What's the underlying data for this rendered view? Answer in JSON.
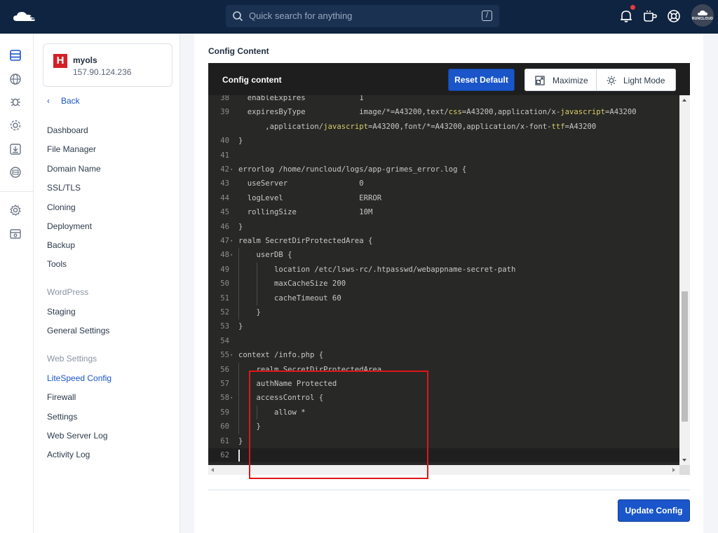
{
  "topbar": {
    "search_placeholder": "Quick search for anything",
    "search_shortcut": "/",
    "avatar_text": "RUNCLOUD",
    "icons": [
      "cloud-logo-icon",
      "search-icon",
      "bell-icon",
      "coffee-cup-icon",
      "help-lifebuoy-icon"
    ]
  },
  "rail": {
    "icons": [
      "servers-icon",
      "globe-icon",
      "bug-icon",
      "settings-cog-icon",
      "download-box-icon",
      "network-globe-icon",
      "gear-icon",
      "archive-box-icon"
    ]
  },
  "server": {
    "name": "myols",
    "ip": "157.90.124.236"
  },
  "sidebar": {
    "back": "Back",
    "items": {
      "dashboard": "Dashboard",
      "file_manager": "File Manager",
      "domain_name": "Domain Name",
      "ssl_tls": "SSL/TLS",
      "cloning": "Cloning",
      "deployment": "Deployment",
      "backup": "Backup",
      "tools": "Tools",
      "wordpress_head": "WordPress",
      "staging": "Staging",
      "general_settings": "General Settings",
      "web_settings_head": "Web Settings",
      "litespeed_config": "LiteSpeed Config",
      "firewall": "Firewall",
      "settings": "Settings",
      "web_server_log": "Web Server Log",
      "activity_log": "Activity Log"
    }
  },
  "main": {
    "title": "Config Content",
    "editor_title": "Config content",
    "reset_label": "Reset Default",
    "maximize_label": "Maximize",
    "light_mode_label": "Light Mode",
    "update_label": "Update Config"
  },
  "code": {
    "lines": [
      {
        "n": "38",
        "fold": "",
        "text": "  enableExpires            1"
      },
      {
        "n": "39",
        "fold": "",
        "text": "  expiresByType            image/*=A43200,text/css=A43200,application/x-javascript=A43200"
      },
      {
        "n": "",
        "fold": "",
        "text": "      ,application/javascript=A43200,font/*=A43200,application/x-font-ttf=A43200"
      },
      {
        "n": "40",
        "fold": "",
        "text": "}"
      },
      {
        "n": "41",
        "fold": "",
        "text": ""
      },
      {
        "n": "42",
        "fold": "▾",
        "text": "errorlog /home/runcloud/logs/app-grimes_error.log {"
      },
      {
        "n": "43",
        "fold": "",
        "text": "  useServer                0"
      },
      {
        "n": "44",
        "fold": "",
        "text": "  logLevel                 ERROR"
      },
      {
        "n": "45",
        "fold": "",
        "text": "  rollingSize              10M"
      },
      {
        "n": "46",
        "fold": "",
        "text": "}"
      },
      {
        "n": "47",
        "fold": "▾",
        "text": "realm SecretDirProtectedArea {"
      },
      {
        "n": "48",
        "fold": "▾",
        "text": "    userDB {"
      },
      {
        "n": "49",
        "fold": "",
        "text": "        location /etc/lsws-rc/.htpasswd/webappname-secret-path"
      },
      {
        "n": "50",
        "fold": "",
        "text": "        maxCacheSize 200"
      },
      {
        "n": "51",
        "fold": "",
        "text": "        cacheTimeout 60"
      },
      {
        "n": "52",
        "fold": "",
        "text": "    }"
      },
      {
        "n": "53",
        "fold": "",
        "text": "}"
      },
      {
        "n": "54",
        "fold": "",
        "text": ""
      },
      {
        "n": "55",
        "fold": "▾",
        "text": "context /info.php {"
      },
      {
        "n": "56",
        "fold": "",
        "text": "    realm SecretDirProtectedArea"
      },
      {
        "n": "57",
        "fold": "",
        "text": "    authName Protected"
      },
      {
        "n": "58",
        "fold": "▾",
        "text": "    accessControl {"
      },
      {
        "n": "59",
        "fold": "",
        "text": "        allow *"
      },
      {
        "n": "60",
        "fold": "",
        "text": "    }"
      },
      {
        "n": "61",
        "fold": "",
        "text": "}"
      },
      {
        "n": "62",
        "fold": "",
        "text": ""
      }
    ]
  },
  "colors": {
    "accent": "#1a56c9",
    "topbar": "#0f2440",
    "editor_bg": "#282826",
    "highlight": "#e01717"
  }
}
